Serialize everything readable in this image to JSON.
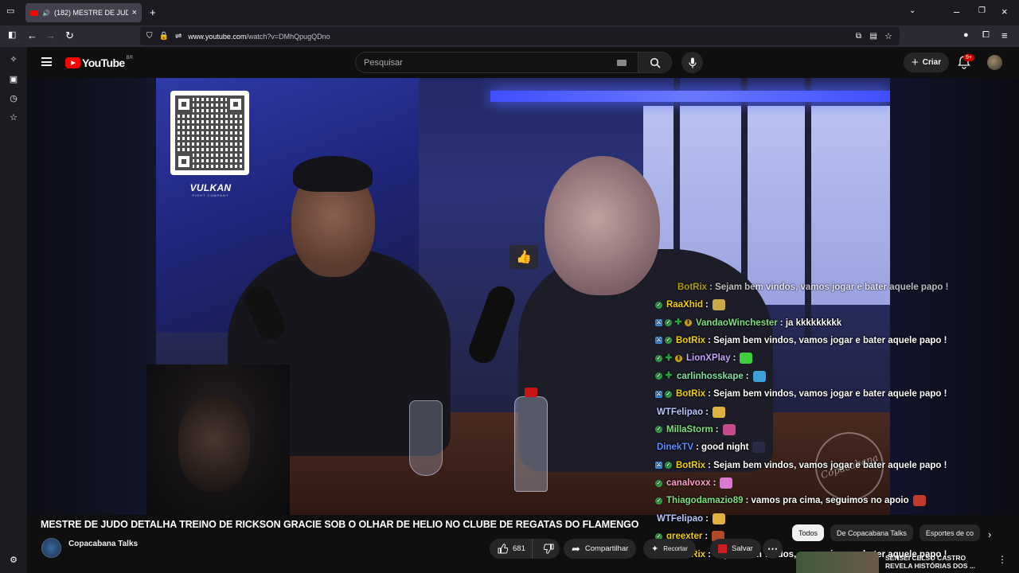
{
  "browser": {
    "tab_title": "(182) MESTRE DE JUDO DE",
    "url_host": "www.youtube.com",
    "url_path": "/watch?v=DMhQpugQDno"
  },
  "header": {
    "logo_text": "YouTube",
    "region": "BR",
    "search_placeholder": "Pesquisar",
    "create_label": "Criar",
    "notif_badge": "9+"
  },
  "overlay": {
    "sponsor": "VULKAN",
    "sponsor_sub": "FIGHT COMPANY",
    "watermark": "Copacabana"
  },
  "chat": {
    "clipped_line": {
      "user": "BotRix",
      "text": ": Sejam bem vindos, vamos jogar e bater aquele papo !"
    },
    "messages": [
      {
        "user": "RaaXhid",
        "text": ":",
        "color": "#f0d000",
        "badges": [
          "sub"
        ],
        "emote": "#c9a74a"
      },
      {
        "user": "VandaoWinchester",
        "text": ": ja kkkkkkkkk",
        "color": "#7fe07f",
        "badges": [
          "mod",
          "sub",
          "vip",
          "bits"
        ],
        "emote": ""
      },
      {
        "user": "BotRix",
        "text": ": Sejam bem vindos, vamos jogar e bater aquele papo !",
        "color": "#f0d000",
        "badges": [
          "mod",
          "sub"
        ],
        "emote": ""
      },
      {
        "user": "LionXPlay",
        "text": ":",
        "color": "#c7a2ff",
        "badges": [
          "sub",
          "vip",
          "bits"
        ],
        "emote": "#3fcf3f"
      },
      {
        "user": "carlinhosskape",
        "text": ":",
        "color": "#7fe0a0",
        "badges": [
          "sub",
          "vip"
        ],
        "emote": "#3aa0d8"
      },
      {
        "user": "BotRix",
        "text": ": Sejam bem vindos, vamos jogar e bater aquele papo !",
        "color": "#f0d000",
        "badges": [
          "mod",
          "sub"
        ],
        "emote": ""
      },
      {
        "user": "WTFelipao",
        "text": ":",
        "color": "#b7c5ff",
        "badges": [],
        "emote": "#e0b040"
      },
      {
        "user": "MillaStorm",
        "text": ":",
        "color": "#7fe07f",
        "badges": [
          "sub"
        ],
        "emote": "#c84a8a"
      },
      {
        "user": "DinekTV",
        "text": ": good night",
        "color": "#5b8cff",
        "badges": [],
        "emote": "#2a2a44"
      },
      {
        "user": "BotRix",
        "text": ": Sejam bem vindos, vamos jogar e bater aquele papo !",
        "color": "#f0d000",
        "badges": [
          "mod",
          "sub"
        ],
        "emote": ""
      },
      {
        "user": "canalvoxx",
        "text": ":",
        "color": "#ff9fc8",
        "badges": [
          "sub"
        ],
        "emote": "#d97ad0"
      },
      {
        "user": "Thiagodamazio89",
        "text": ": vamos pra cima, seguimos no apoio",
        "color": "#7fe07f",
        "badges": [
          "sub"
        ],
        "emote": "#c0392b"
      },
      {
        "user": "WTFelipao",
        "text": ":",
        "color": "#b7c5ff",
        "badges": [],
        "emote": "#e0b040"
      },
      {
        "user": "greexter",
        "text": ":",
        "color": "#f0d000",
        "badges": [
          "sub"
        ],
        "emote": "#b24a2a"
      },
      {
        "user": "BotRix",
        "text": ": Sejam bem vindos, vamos jogar e bater aquele papo !",
        "color": "#f0d000",
        "badges": [
          "mod",
          "sub"
        ],
        "emote": ""
      }
    ]
  },
  "video": {
    "title": "MESTRE DE JUDO DETALHA TREINO DE RICKSON GRACIE SOB O OLHAR DE HELIO NO CLUBE DE REGATAS DO FLAMENGO",
    "channel": "Copacabana Talks",
    "likes": "681",
    "share_label": "Compartilhar",
    "clip_label": "Recortar",
    "save_label": "Salvar"
  },
  "recommendations": {
    "chips": [
      "Todos",
      "De Copacabana Talks",
      "Esportes de co"
    ],
    "first_title": "SENSEI CELSO CASTRO REVELA HISTÓRIAS DOS ..."
  },
  "colors": {
    "brand_red": "#ff0000",
    "bg": "#0f0f0f",
    "chrome": "#2b2a33"
  }
}
